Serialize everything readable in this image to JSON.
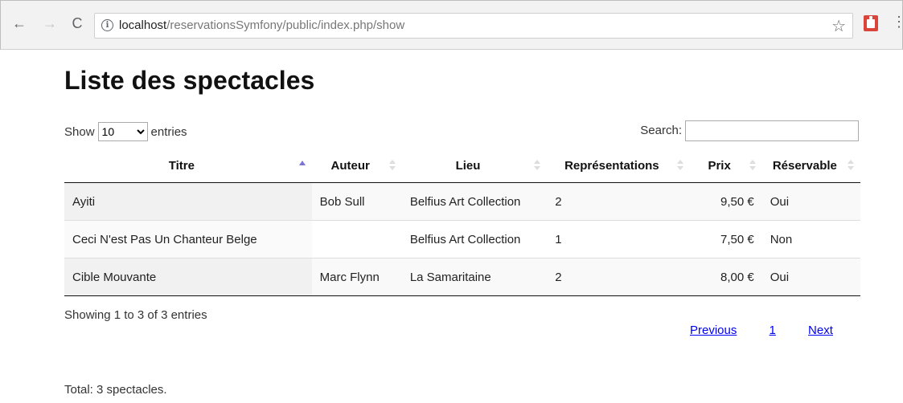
{
  "browser": {
    "url_host": "localhost",
    "url_path": "/reservationsSymfony/public/index.php/show"
  },
  "page": {
    "title": "Liste des spectacles",
    "length_prefix": "Show",
    "length_value": "10",
    "length_suffix": "entries",
    "search_label": "Search:",
    "search_value": ""
  },
  "table": {
    "columns": [
      "Titre",
      "Auteur",
      "Lieu",
      "Représentations",
      "Prix",
      "Réservable"
    ],
    "rows": [
      [
        "Ayiti",
        "Bob Sull",
        "Belfius Art Collection",
        "2",
        "9,50 €",
        "Oui"
      ],
      [
        "Ceci N'est Pas Un Chanteur Belge",
        "",
        "Belfius Art Collection",
        "1",
        "7,50 €",
        "Non"
      ],
      [
        "Cible Mouvante",
        "Marc Flynn",
        "La Samaritaine",
        "2",
        "8,00 €",
        "Oui"
      ]
    ]
  },
  "footer": {
    "info": "Showing 1 to 3 of 3 entries",
    "previous": "Previous",
    "page": "1",
    "next": "Next",
    "total": "Total: 3 spectacles."
  }
}
